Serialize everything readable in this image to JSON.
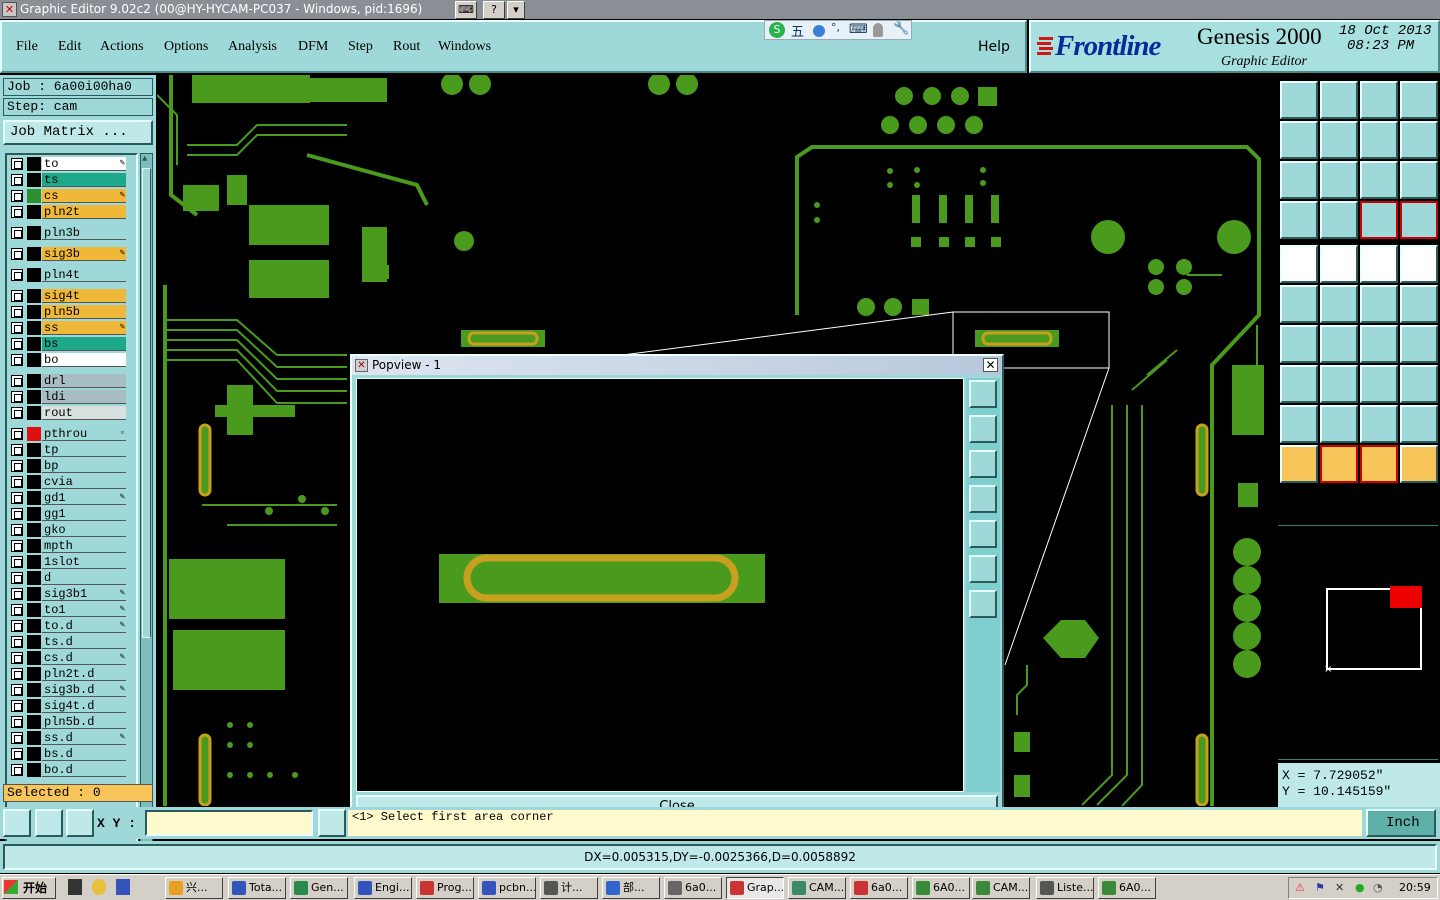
{
  "window": {
    "title": "Graphic Editor 9.02c2 (00@HY-HYCAM-PC037 - Windows, pid:1696)"
  },
  "menu": [
    "File",
    "Edit",
    "Actions",
    "Options",
    "Analysis",
    "DFM",
    "Step",
    "Rout",
    "Windows"
  ],
  "help_label": "Help",
  "ime": {
    "label": "五"
  },
  "brand": {
    "logo": "Frontline",
    "product": "Genesis 2000",
    "date": "18 Oct 2013",
    "time": "08:23 PM",
    "subtitle": "Graphic Editor"
  },
  "job": {
    "job_line": "Job : 6a00i00ha0",
    "step_line": "Step: cam",
    "matrix_button": "Job Matrix ..."
  },
  "layers": [
    {
      "name": "to",
      "bg": "#ffffff",
      "swatch": "#000000",
      "mark": "✎"
    },
    {
      "name": "ts",
      "bg": "#1ea88a",
      "swatch": "#000000",
      "mark": ""
    },
    {
      "name": "cs",
      "bg": "#f0b838",
      "swatch": "#2d8f2d",
      "mark": "✎"
    },
    {
      "name": "pln2t",
      "bg": "#f0b838",
      "swatch": "#000000",
      "mark": ""
    },
    {
      "name": "pln3b",
      "bg": "#9fd8d8",
      "swatch": "#000000",
      "mark": ""
    },
    {
      "name": "sig3b",
      "bg": "#f0b838",
      "swatch": "#000000",
      "mark": "✎"
    },
    {
      "name": "pln4t",
      "bg": "#9fd8d8",
      "swatch": "#000000",
      "mark": ""
    },
    {
      "name": "sig4t",
      "bg": "#f0b838",
      "swatch": "#000000",
      "mark": ""
    },
    {
      "name": "pln5b",
      "bg": "#f0b838",
      "swatch": "#000000",
      "mark": ""
    },
    {
      "name": "ss",
      "bg": "#f0b838",
      "swatch": "#000000",
      "mark": "✎"
    },
    {
      "name": "bs",
      "bg": "#1ea88a",
      "swatch": "#000000",
      "mark": ""
    },
    {
      "name": "bo",
      "bg": "#ffffff",
      "swatch": "#000000",
      "mark": ""
    },
    {
      "name": "drl",
      "bg": "#a8bcc4",
      "swatch": "#000000",
      "mark": ""
    },
    {
      "name": "ldi",
      "bg": "#a8bcc4",
      "swatch": "#000000",
      "mark": ""
    },
    {
      "name": "rout",
      "bg": "#d8e0e0",
      "swatch": "#000000",
      "mark": ""
    },
    {
      "name": "pthrou",
      "bg": "#9fd8d8",
      "swatch": "#e01010",
      "mark": "▫"
    },
    {
      "name": "tp",
      "bg": "#9fd8d8",
      "swatch": "#000000",
      "mark": ""
    },
    {
      "name": "bp",
      "bg": "#9fd8d8",
      "swatch": "#000000",
      "mark": ""
    },
    {
      "name": "cvia",
      "bg": "#9fd8d8",
      "swatch": "#000000",
      "mark": ""
    },
    {
      "name": "gd1",
      "bg": "#9fd8d8",
      "swatch": "#000000",
      "mark": "✎"
    },
    {
      "name": "gg1",
      "bg": "#9fd8d8",
      "swatch": "#000000",
      "mark": ""
    },
    {
      "name": "gko",
      "bg": "#9fd8d8",
      "swatch": "#000000",
      "mark": ""
    },
    {
      "name": "mpth",
      "bg": "#9fd8d8",
      "swatch": "#000000",
      "mark": ""
    },
    {
      "name": "1slot",
      "bg": "#9fd8d8",
      "swatch": "#000000",
      "mark": ""
    },
    {
      "name": "d",
      "bg": "#9fd8d8",
      "swatch": "#000000",
      "mark": ""
    },
    {
      "name": "sig3b1",
      "bg": "#9fd8d8",
      "swatch": "#000000",
      "mark": "✎"
    },
    {
      "name": "to1",
      "bg": "#9fd8d8",
      "swatch": "#000000",
      "mark": "✎"
    },
    {
      "name": "to.d",
      "bg": "#9fd8d8",
      "swatch": "#000000",
      "mark": "✎"
    },
    {
      "name": "ts.d",
      "bg": "#9fd8d8",
      "swatch": "#000000",
      "mark": ""
    },
    {
      "name": "cs.d",
      "bg": "#9fd8d8",
      "swatch": "#000000",
      "mark": "✎"
    },
    {
      "name": "pln2t.d",
      "bg": "#9fd8d8",
      "swatch": "#000000",
      "mark": ""
    },
    {
      "name": "sig3b.d",
      "bg": "#9fd8d8",
      "swatch": "#000000",
      "mark": "✎"
    },
    {
      "name": "sig4t.d",
      "bg": "#9fd8d8",
      "swatch": "#000000",
      "mark": ""
    },
    {
      "name": "pln5b.d",
      "bg": "#9fd8d8",
      "swatch": "#000000",
      "mark": ""
    },
    {
      "name": "ss.d",
      "bg": "#9fd8d8",
      "swatch": "#000000",
      "mark": "✎"
    },
    {
      "name": "bs.d",
      "bg": "#9fd8d8",
      "swatch": "#000000",
      "mark": ""
    },
    {
      "name": "bo.d",
      "bg": "#9fd8d8",
      "swatch": "#000000",
      "mark": ""
    }
  ],
  "selected": "Selected : 0",
  "popview": {
    "title": "Popview - 1",
    "close_label": "Close"
  },
  "coords": {
    "x": "X = 7.729052\"",
    "y": "Y = 10.145159\""
  },
  "command": {
    "xy_label": "X Y :",
    "xy_value": "",
    "message": "<1>  Select first area corner",
    "unit": "Inch"
  },
  "status": "DX=0.005315,DY=-0.0025366,D=0.0058892",
  "colors": {
    "copper": "#4a9a1e",
    "pad_ring": "#c8a020",
    "panel": "#9fd8d8"
  },
  "taskbar": {
    "start": "开始",
    "tasks": [
      "兴...",
      "Tota...",
      "Gen...",
      "Engi...",
      "Prog...",
      "pcbn...",
      "计...",
      "部...",
      "6a0...",
      "Grap...",
      "CAM...",
      "6a0...",
      "6A0...",
      "CAM...",
      "Liste...",
      "6A0..."
    ],
    "clock": "20:59"
  }
}
